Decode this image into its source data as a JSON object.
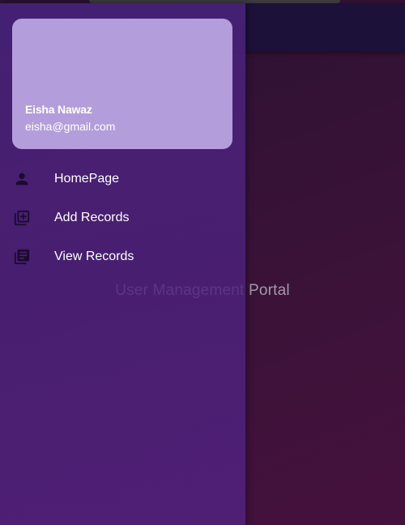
{
  "app": {
    "center_title": "User Management Portal"
  },
  "drawer": {
    "account": {
      "name": "Eisha Nawaz",
      "email": "eisha@gmail.com"
    },
    "items": [
      {
        "label": "HomePage",
        "icon": "person-icon"
      },
      {
        "label": "Add Records",
        "icon": "library-add-icon"
      },
      {
        "label": "View Records",
        "icon": "library-books-icon"
      }
    ]
  },
  "colors": {
    "header_card": "#b39ddb",
    "drawer": "#4c2380",
    "appbar": "#1c1138",
    "background": "#3a1238",
    "icon": "#1a0b2e"
  }
}
